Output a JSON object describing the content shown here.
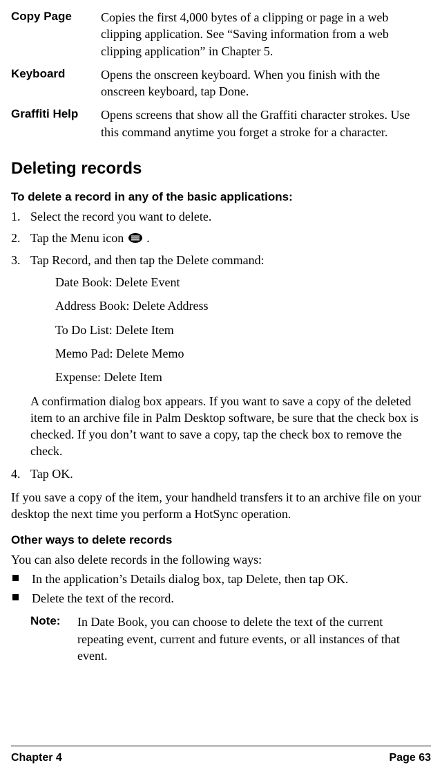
{
  "definitions": [
    {
      "term": "Copy Page",
      "desc": "Copies the first 4,000 bytes of a clipping or page in a web clipping application. See “Saving information from a web clipping application” in Chapter 5."
    },
    {
      "term": "Keyboard",
      "desc": "Opens the onscreen keyboard. When you finish with the onscreen keyboard, tap Done."
    },
    {
      "term": "Graffiti Help",
      "desc": "Opens screens that show all the Graffiti character strokes. Use this command anytime you forget a stroke for a character."
    }
  ],
  "section_heading": "Deleting records",
  "subhead": "To delete a record in any of the basic applications:",
  "steps": {
    "s1": "Select the record you want to delete.",
    "s2a": "Tap the Menu icon ",
    "s2b": " .",
    "s3": "Tap Record, and then tap the Delete command:",
    "s3_sub": [
      "Date Book: Delete Event",
      "Address Book: Delete Address",
      "To Do List: Delete Item",
      "Memo Pad: Delete Memo",
      "Expense: Delete Item"
    ],
    "s3_para": "A confirmation dialog box appears. If you want to save a copy of the deleted item to an archive file in Palm Desktop software, be sure that the check box is checked. If you don’t want to save a copy, tap the check box to remove the check.",
    "s4": "Tap OK."
  },
  "after_para": "If you save a copy of the item, your handheld transfers it to an archive file on your desktop the next time you perform a HotSync operation.",
  "mini_head": "Other ways to delete records",
  "mini_intro": "You can also delete records in the following ways:",
  "bullets": [
    "In the application’s Details dialog box, tap Delete, then tap OK.",
    "Delete the text of the record."
  ],
  "note": {
    "label": "Note:",
    "text": "In Date Book, you can choose to delete the text of the current repeating event, current and future events, or all instances of that event."
  },
  "footer": {
    "left": "Chapter 4",
    "right": "Page 63"
  }
}
